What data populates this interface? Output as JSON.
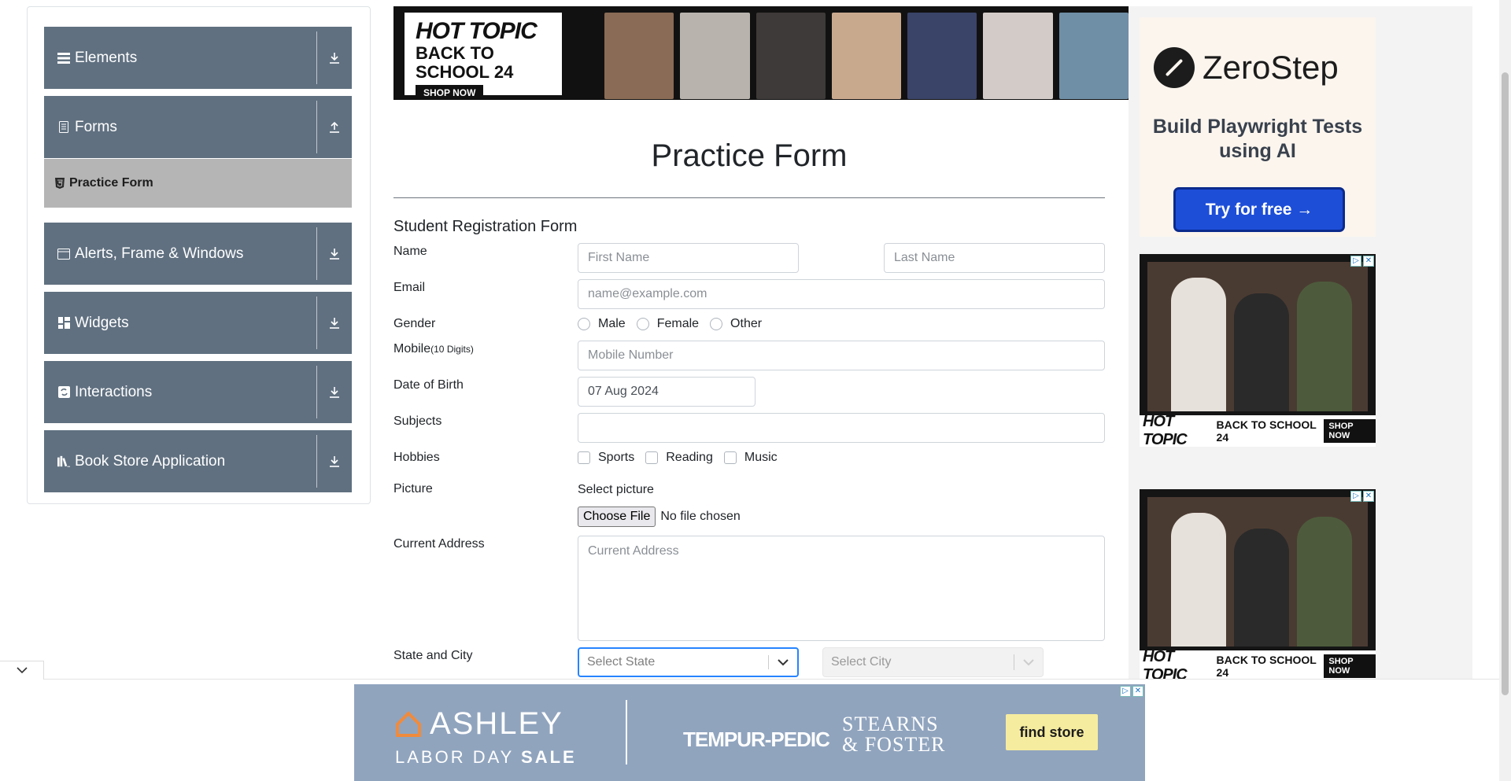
{
  "sidebar": {
    "groups": [
      {
        "label": "Elements",
        "icon": "list-icon",
        "toggle": "download-icon"
      },
      {
        "label": "Forms",
        "icon": "document-icon",
        "toggle": "upload-icon"
      },
      {
        "label": "Alerts, Frame & Windows",
        "icon": "window-icon",
        "toggle": "download-icon"
      },
      {
        "label": "Widgets",
        "icon": "grid-icon",
        "toggle": "download-icon"
      },
      {
        "label": "Interactions",
        "icon": "interaction-icon",
        "toggle": "download-icon"
      },
      {
        "label": "Book Store Application",
        "icon": "books-icon",
        "toggle": "download-icon"
      }
    ],
    "active_item": {
      "label": "Practice Form",
      "icon": "html5-icon"
    }
  },
  "top_ad": {
    "brand": "HOT TOPIC",
    "headline": "BACK TO SCHOOL 24",
    "cta": "SHOP NOW"
  },
  "form": {
    "title": "Practice Form",
    "subtitle": "Student Registration Form",
    "name_label": "Name",
    "first_name_placeholder": "First Name",
    "last_name_placeholder": "Last Name",
    "email_label": "Email",
    "email_placeholder": "name@example.com",
    "gender_label": "Gender",
    "gender_options": [
      "Male",
      "Female",
      "Other"
    ],
    "mobile_label": "Mobile",
    "mobile_hint": "(10 Digits)",
    "mobile_placeholder": "Mobile Number",
    "dob_label": "Date of Birth",
    "dob_value": "07 Aug 2024",
    "subjects_label": "Subjects",
    "hobbies_label": "Hobbies",
    "hobby_options": [
      "Sports",
      "Reading",
      "Music"
    ],
    "picture_label": "Picture",
    "select_picture_label": "Select picture",
    "choose_file_label": "Choose File",
    "no_file_label": "No file chosen",
    "address_label": "Current Address",
    "address_placeholder": "Current Address",
    "state_city_label": "State and City",
    "state_placeholder": "Select State",
    "city_placeholder": "Select City"
  },
  "right_ads": {
    "zerostep": {
      "brand": "ZeroStep",
      "tagline": "Build Playwright Tests using AI",
      "cta": "Try for free →"
    },
    "hottopic": {
      "brand": "HOT TOPIC",
      "headline": "BACK TO SCHOOL 24",
      "cta": "SHOP NOW"
    }
  },
  "bottom_ad": {
    "brand": "ASHLEY",
    "sale": "LABOR DAY",
    "sale_bold": "SALE",
    "partner1": "TEMPUR-PEDIC",
    "partner2_line1": "STEARNS",
    "partner2_line2": "& FOSTER",
    "cta": "find store"
  },
  "colors": {
    "nav_group": "#607080",
    "nav_active": "#b5b5b5",
    "focus_border": "#2684ff",
    "zerostep_button": "#1d4ed8",
    "ashley_bg": "#90a4be",
    "find_store_bg": "#f6ec9f"
  }
}
